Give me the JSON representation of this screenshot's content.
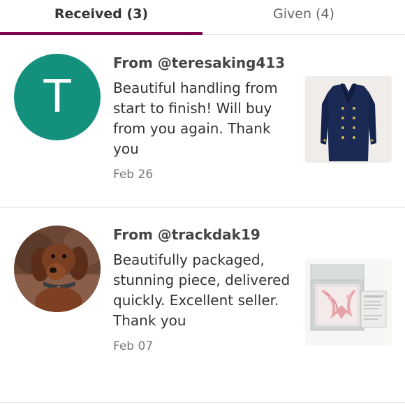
{
  "tabs": {
    "received_label": "Received (3)",
    "given_label": "Given (4)",
    "active": "received"
  },
  "reviews": [
    {
      "from": "From @teresaking413",
      "comment": "Beautiful handling from start to finish! Will buy from you again. Thank you",
      "date": "Feb 26",
      "avatar_letter": "T",
      "avatar_color": "#13917c",
      "thumbnail": "navy-double-breasted-coat-photo"
    },
    {
      "from": "From @trackdak19",
      "comment": "Beautifully packaged, stunning piece, delivered quickly. Excellent seller. Thank you",
      "date": "Feb 07",
      "avatar": "dachshund-photo",
      "thumbnail": "pink-necklace-in-gift-box-photo"
    }
  ],
  "colors": {
    "accent": "#7f0353",
    "text": "#333333",
    "muted": "#777777",
    "divider": "#e6e6e6"
  }
}
